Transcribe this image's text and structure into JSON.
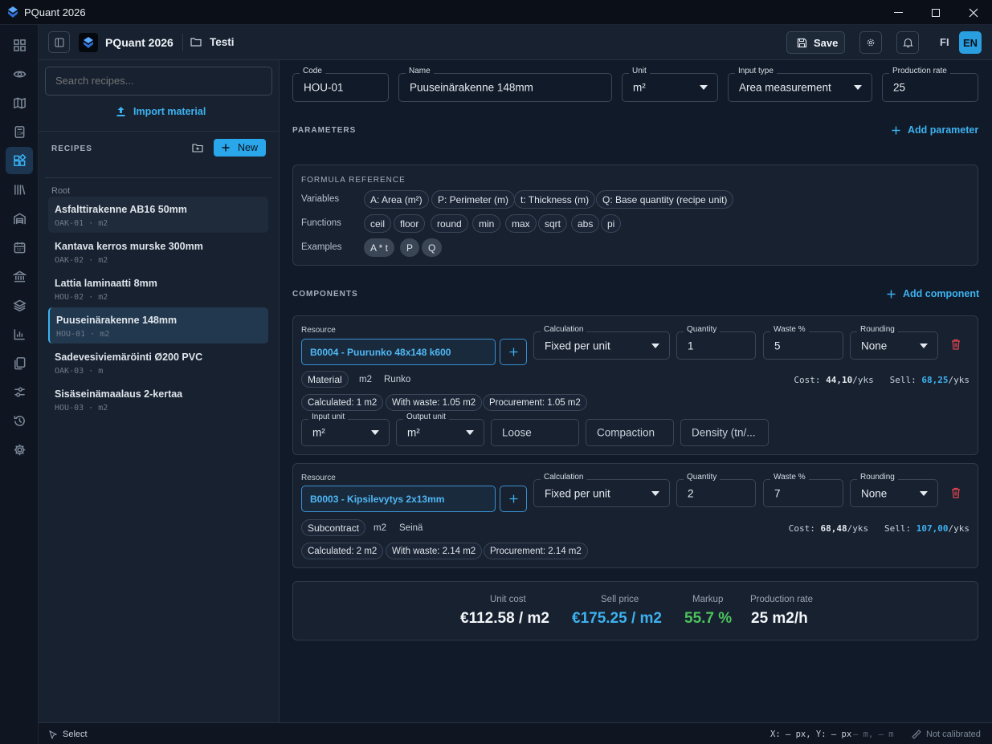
{
  "window": {
    "title": "PQuant 2026"
  },
  "header": {
    "app_name": "PQuant 2026",
    "project": "Testi",
    "save_label": "Save",
    "lang_fi": "FI",
    "lang_en": "EN"
  },
  "sidebar": {
    "search_placeholder": "Search recipes...",
    "import_label": "Import material",
    "recipes_heading": "RECIPES",
    "new_label": "New",
    "root_label": "Root",
    "recipes": [
      {
        "name": "Asfalttirakenne AB16 50mm",
        "code": "OAK-01",
        "unit": "m2"
      },
      {
        "name": "Kantava kerros murske 300mm",
        "code": "OAK-02",
        "unit": "m2"
      },
      {
        "name": "Lattia laminaatti 8mm",
        "code": "HOU-02",
        "unit": "m2"
      },
      {
        "name": "Puuseinärakenne 148mm",
        "code": "HOU-01",
        "unit": "m2"
      },
      {
        "name": "Sadevesiviemäröinti Ø200 PVC",
        "code": "OAK-03",
        "unit": "m"
      },
      {
        "name": "Sisäseinämaalaus 2-kertaa",
        "code": "HOU-03",
        "unit": "m2"
      }
    ],
    "sep": "·"
  },
  "recipe": {
    "code_label": "Code",
    "code": "HOU-01",
    "name_label": "Name",
    "name": "Puuseinärakenne 148mm",
    "unit_label": "Unit",
    "unit": "m²",
    "input_type_label": "Input type",
    "input_type": "Area measurement",
    "production_rate_label": "Production rate",
    "production_rate": "25"
  },
  "parameters": {
    "heading": "PARAMETERS",
    "add_label": "Add parameter"
  },
  "formula": {
    "heading": "FORMULA REFERENCE",
    "variables_label": "Variables",
    "variables": [
      "A: Area (m²)",
      "P: Perimeter (m)",
      "t: Thickness (m)",
      "Q: Base quantity (recipe unit)"
    ],
    "functions_label": "Functions",
    "functions": [
      "ceil",
      "floor",
      "round",
      "min",
      "max",
      "sqrt",
      "abs",
      "pi"
    ],
    "examples_label": "Examples",
    "examples": [
      "A * t",
      "P",
      "Q"
    ]
  },
  "components": {
    "heading": "COMPONENTS",
    "add_label": "Add component",
    "labels": {
      "resource": "Resource",
      "calculation": "Calculation",
      "quantity": "Quantity",
      "waste": "Waste %",
      "rounding": "Rounding",
      "input_unit": "Input unit",
      "output_unit": "Output unit",
      "cost": "Cost:",
      "sell": "Sell:",
      "per": "/yks"
    },
    "items": [
      {
        "resource": "B0004 - Puurunko 48x148 k600",
        "calculation": "Fixed per unit",
        "quantity": "1",
        "waste": "5",
        "rounding": "None",
        "type": "Material",
        "unit": "m2",
        "group": "Runko",
        "cost": "44,10",
        "sell": "68,25",
        "calculated": "Calculated: 1 m2",
        "with_waste": "With waste: 1.05 m2",
        "procurement": "Procurement: 1.05 m2",
        "input_unit": "m²",
        "output_unit": "m²",
        "loose": "Loose",
        "compaction": "Compaction",
        "density": "Density (tn/..."
      },
      {
        "resource": "B0003 - Kipsilevytys 2x13mm",
        "calculation": "Fixed per unit",
        "quantity": "2",
        "waste": "7",
        "rounding": "None",
        "type": "Subcontract",
        "unit": "m2",
        "group": "Seinä",
        "cost": "68,48",
        "sell": "107,00",
        "calculated": "Calculated: 2 m2",
        "with_waste": "With waste: 2.14 m2",
        "procurement": "Procurement: 2.14 m2"
      }
    ]
  },
  "summary": {
    "unit_cost_label": "Unit cost",
    "unit_cost": "€112.58 / m2",
    "sell_price_label": "Sell price",
    "sell_price": "€175.25 / m2",
    "markup_label": "Markup",
    "markup": "55.7 %",
    "production_rate_label": "Production rate",
    "production_rate": "25 m2/h"
  },
  "status": {
    "tool": "Select",
    "coords": "X: — px, Y: — px",
    "coords_m": "— m, — m",
    "calibration": "Not calibrated"
  },
  "colors": {
    "accent": "#38b0f2",
    "green": "#4cc35c",
    "danger": "#e0454f"
  }
}
